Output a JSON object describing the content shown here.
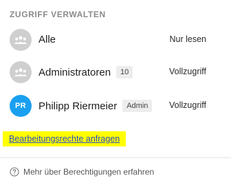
{
  "section": {
    "title": "ZUGRIFF VERWALTEN"
  },
  "entries": [
    {
      "avatar_icon": "group-icon",
      "name": "Alle",
      "badge": "",
      "permission": "Nur lesen"
    },
    {
      "avatar_icon": "group-icon",
      "name": "Administratoren",
      "badge": "10",
      "permission": "Vollzugriff"
    },
    {
      "avatar_initials": "PR",
      "avatar_color": "#1aa0f0",
      "name": "Philipp Riermeier",
      "badge": "Admin",
      "permission": "Vollzugriff"
    }
  ],
  "request_link": {
    "label": "Bearbeitungsrechte anfragen",
    "highlight_color": "#ffff00"
  },
  "help": {
    "icon": "help-circle-icon",
    "label": "Mehr über Berechtigungen erfahren"
  }
}
